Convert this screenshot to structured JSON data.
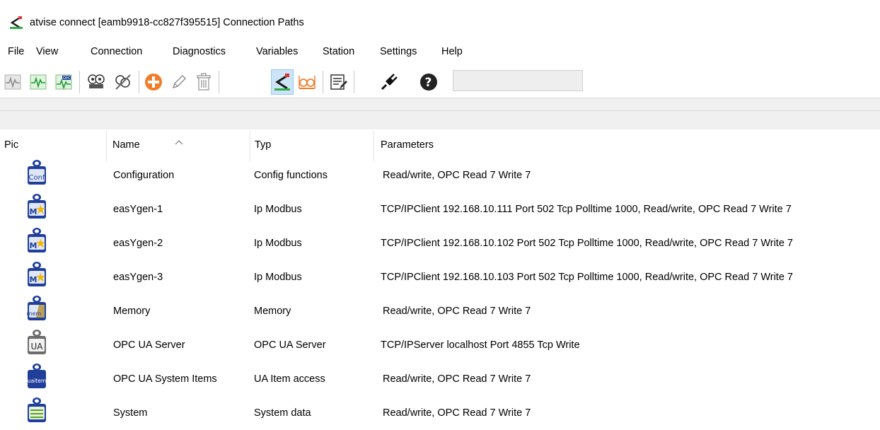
{
  "window": {
    "title": "atvise connect [eamb9918-cc827f395515] Connection Paths"
  },
  "menu": [
    "File",
    "View",
    "Connection",
    "Diagnostics",
    "Variables",
    "Station",
    "Settings",
    "Help"
  ],
  "toolbar": {
    "buttons": [
      "pulse-icon",
      "pulse-green-icon",
      "opc-pulse-icon",
      "connect-icon",
      "disconnect-icon",
      "add-icon",
      "edit-icon",
      "delete-icon",
      "share-icon",
      "glasses-icon",
      "list-edit-icon",
      "plug-icon",
      "help-icon"
    ],
    "active": "share-icon",
    "field_value": ""
  },
  "table": {
    "columns": [
      "Pic",
      "Name",
      "Typ",
      "Parameters"
    ],
    "sorted_column": "Name",
    "rows": [
      {
        "icon": "conf-icon",
        "icon_text": "Conf",
        "name": "Configuration",
        "typ": "Config functions",
        "params": "Read/write, OPC Read 7 Write 7"
      },
      {
        "icon": "modbus-icon",
        "icon_text": "M",
        "name": "easYgen-1",
        "typ": "Ip Modbus",
        "params": "TCP/IPClient 192.168.10.111 Port 502 Tcp  Polltime 1000, Read/write, OPC Read 7 Write 7"
      },
      {
        "icon": "modbus-icon",
        "icon_text": "M",
        "name": "easYgen-2",
        "typ": "Ip Modbus",
        "params": "TCP/IPClient 192.168.10.102 Port 502 Tcp  Polltime 1000, Read/write, OPC Read 7 Write 7"
      },
      {
        "icon": "modbus-icon",
        "icon_text": "M",
        "name": "easYgen-3",
        "typ": "Ip Modbus",
        "params": "TCP/IPClient 192.168.10.103 Port 502 Tcp  Polltime 1000, Read/write, OPC Read 7 Write 7"
      },
      {
        "icon": "memory-icon",
        "icon_text": "mem",
        "name": "Memory",
        "typ": "Memory",
        "params": "Read/write, OPC Read 7 Write 7"
      },
      {
        "icon": "ua-server-icon",
        "icon_text": "UA",
        "name": "OPC UA Server",
        "typ": "OPC UA Server",
        "params": "TCP/IPServer localhost Port 4855 Tcp  Write"
      },
      {
        "icon": "uaitem-icon",
        "icon_text": "uaitem",
        "name": "OPC UA System Items",
        "typ": "UA Item access",
        "params": "Read/write, OPC Read 7 Write 7"
      },
      {
        "icon": "system-icon",
        "icon_text": "",
        "name": "System",
        "typ": "System data",
        "params": "Read/write, OPC Read 7 Write 7"
      }
    ]
  },
  "colors": {
    "active_button": "#cce4f7",
    "icon_blue": "#1f3f9a",
    "add_orange": "#f07d2a"
  }
}
